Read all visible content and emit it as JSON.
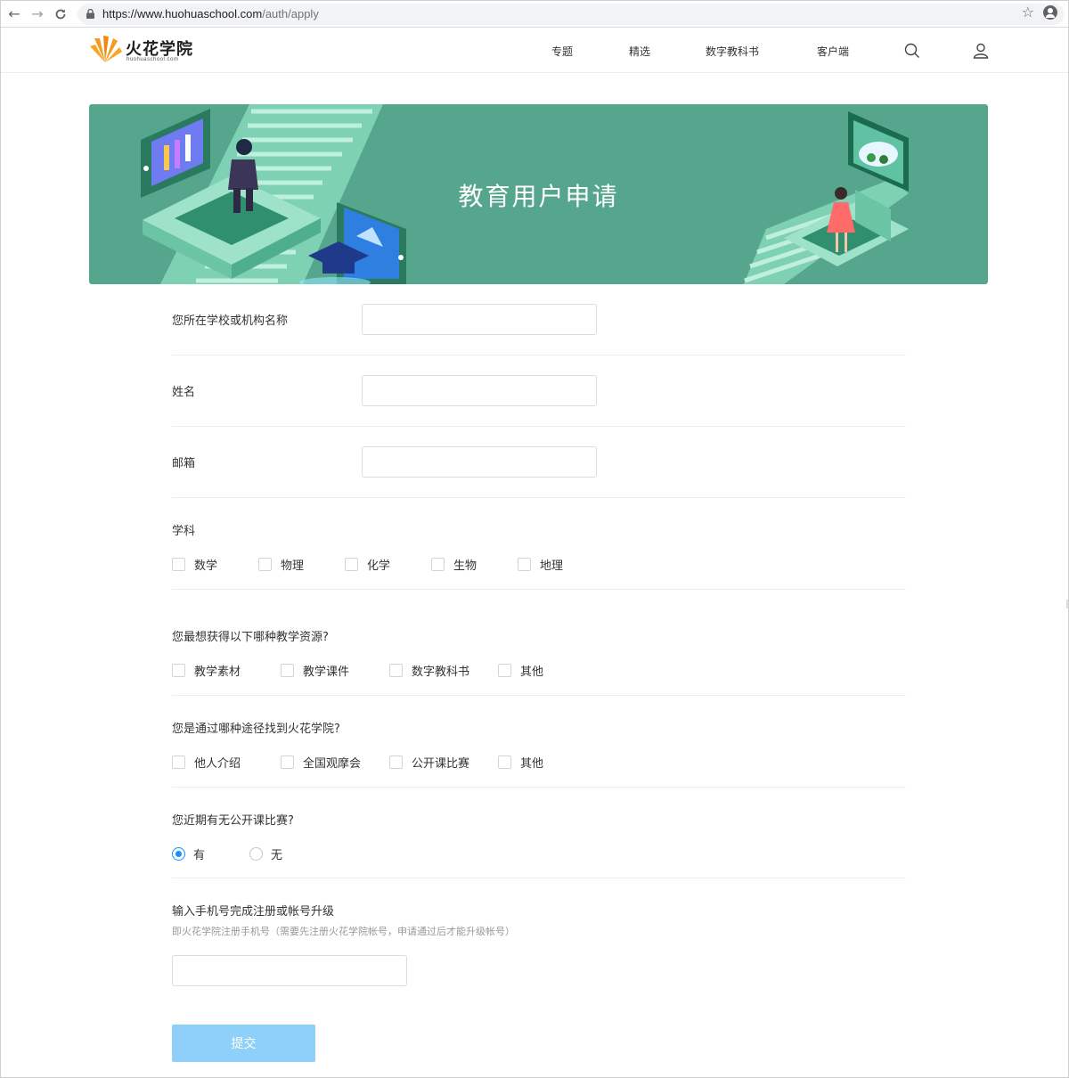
{
  "browser": {
    "url_host": "https://www.huohuaschool.com",
    "url_path": "/auth/apply"
  },
  "header": {
    "logo_title": "火花学院",
    "logo_subtitle": "huohuaschool.com",
    "menu": [
      "专题",
      "精选",
      "数字教科书",
      "客户端"
    ],
    "icons": [
      "search-icon",
      "user-icon"
    ]
  },
  "banner": {
    "title": "教育用户申请",
    "background": "#56a68d"
  },
  "form": {
    "school_label": "您所在学校或机构名称",
    "school_value": "",
    "name_label": "姓名",
    "name_value": "",
    "email_label": "邮箱",
    "email_value": "",
    "subject": {
      "label": "学科",
      "options": [
        "数学",
        "物理",
        "化学",
        "生物",
        "地理"
      ]
    },
    "resources": {
      "label": "您最想获得以下哪种教学资源?",
      "options": [
        "教学素材",
        "教学课件",
        "数字教科书",
        "其他"
      ]
    },
    "source": {
      "label": "您是通过哪种途径找到火花学院?",
      "options": [
        "他人介绍",
        "全国观摩会",
        "公开课比赛",
        "其他"
      ]
    },
    "contest": {
      "label": "您近期有无公开课比赛?",
      "options": [
        "有",
        "无"
      ],
      "selected": "有"
    },
    "phone": {
      "label": "输入手机号完成注册或帐号升级",
      "hint": "即火花学院注册手机号（需要先注册火花学院帐号，申请通过后才能升级帐号）",
      "value": ""
    },
    "submit_label": "提交"
  },
  "colors": {
    "accent": "#1890ff",
    "submit_bg": "#8fd0fa",
    "banner": "#56a68d",
    "logo_orange": "#f39c1f"
  }
}
